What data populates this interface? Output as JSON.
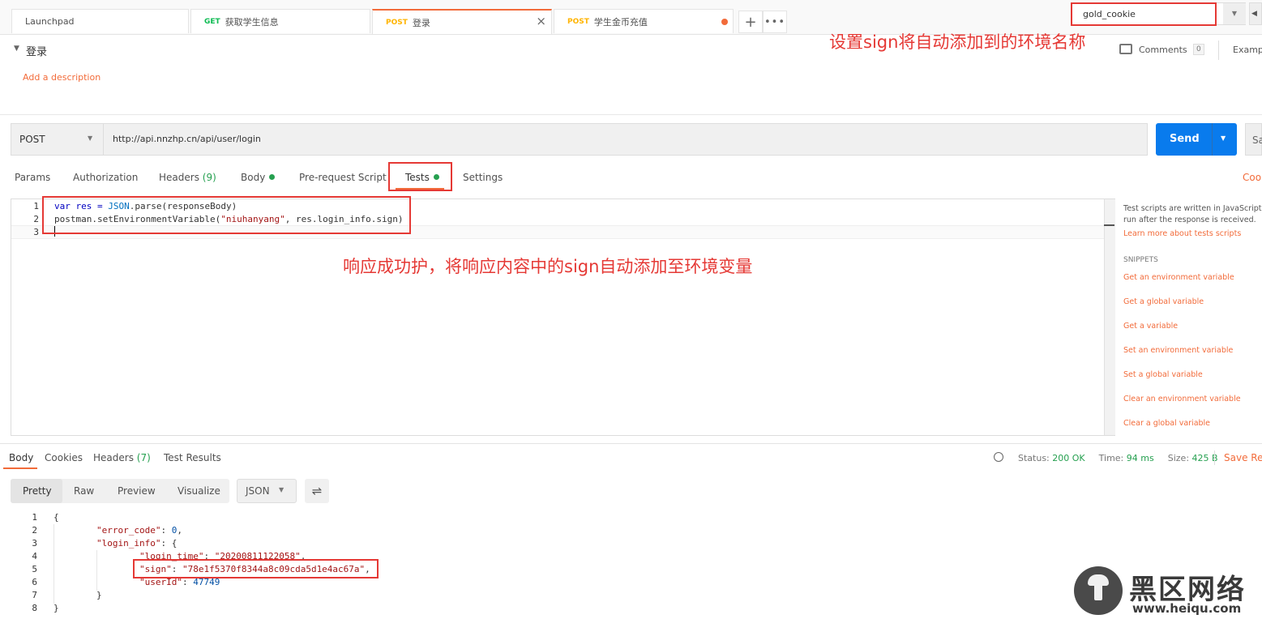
{
  "tabs": [
    {
      "method": "",
      "label": "Launchpad"
    },
    {
      "method": "GET",
      "label": "获取学生信息"
    },
    {
      "method": "POST",
      "label": "登录"
    },
    {
      "method": "POST",
      "label": "学生金币充值"
    }
  ],
  "environment": {
    "selected": "gold_cookie"
  },
  "request": {
    "title": "登录",
    "add_description": "Add a description",
    "comments_label": "Comments",
    "comments_count": "0",
    "examples_label": "Examp",
    "method": "POST",
    "url": "http://api.nnzhp.cn/api/user/login",
    "send_label": "Send",
    "save_label": "Sa",
    "cookies_label": "Cook",
    "tabs": [
      {
        "label": "Params"
      },
      {
        "label": "Authorization"
      },
      {
        "label": "Headers",
        "count": "(9)"
      },
      {
        "label": "Body"
      },
      {
        "label": "Pre-request Script"
      },
      {
        "label": "Tests"
      },
      {
        "label": "Settings"
      }
    ]
  },
  "tests_code": {
    "line_numbers": [
      "1",
      "2",
      "3"
    ],
    "line1_a": "var res = ",
    "line1_b": "JSON",
    "line1_c": ".parse(responseBody)",
    "line2_a": "postman.setEnvironmentVariable(",
    "line2_b": "\"niuhanyang\"",
    "line2_c": ", res.login_info.sign)"
  },
  "snippets_panel": {
    "intro1": "Test scripts are written in JavaScript, and",
    "intro2": "run after the response is received.",
    "learn_more": "Learn more about tests scripts",
    "header": "SNIPPETS",
    "items": [
      "Get an environment variable",
      "Get a global variable",
      "Get a variable",
      "Set an environment variable",
      "Set a global variable",
      "Clear an environment variable",
      "Clear a global variable"
    ]
  },
  "response": {
    "tabs": [
      {
        "label": "Body"
      },
      {
        "label": "Cookies"
      },
      {
        "label": "Headers",
        "count": "(7)"
      },
      {
        "label": "Test Results"
      }
    ],
    "status_label": "Status:",
    "status_value": "200 OK",
    "time_label": "Time:",
    "time_value": "94 ms",
    "size_label": "Size:",
    "size_value": "425 B",
    "save_label": "Save Res",
    "format_buttons": [
      "Pretty",
      "Raw",
      "Preview",
      "Visualize"
    ],
    "format_select": "JSON",
    "line_numbers": [
      "1",
      "2",
      "3",
      "4",
      "5",
      "6",
      "7",
      "8"
    ],
    "json": {
      "open": "{",
      "error_code_key": "\"error_code\"",
      "error_code_val": "0",
      "login_info_key": "\"login_info\"",
      "login_time_key": "\"login_time\"",
      "login_time_val": "\"20200811122058\"",
      "sign_key": "\"sign\"",
      "sign_val": "\"78e1f5370f8344a8c09cda5d1e4ac67a\"",
      "userid_key": "\"userId\"",
      "userid_val": "47749",
      "close_inner": "}",
      "close": "}"
    }
  },
  "annotations": {
    "env_note": "设置sign将自动添加到的环境名称",
    "tests_note": "响应成功护，将响应内容中的sign自动添加至环境变量"
  },
  "watermark": {
    "text": "黑区网络",
    "url": "www.heiqu.com"
  },
  "colors": {
    "accent": "#f26b3a",
    "send": "#097bed",
    "annotation": "#e53935",
    "ok": "#26a050"
  }
}
